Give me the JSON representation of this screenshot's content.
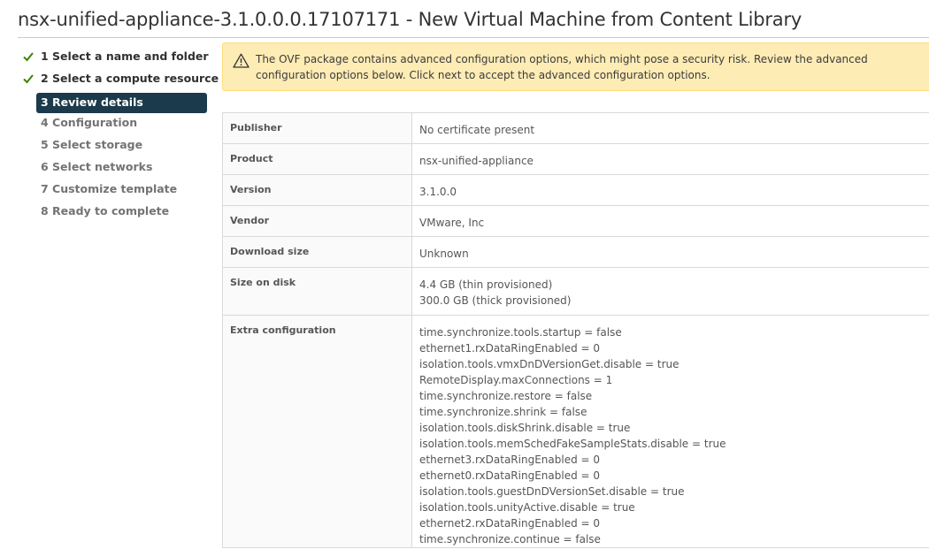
{
  "window": {
    "title": "nsx-unified-appliance-3.1.0.0.0.17107171 - New Virtual Machine from Content Library"
  },
  "steps": [
    {
      "label": "1 Select a name and folder",
      "state": "done"
    },
    {
      "label": "2 Select a compute resource",
      "state": "done"
    },
    {
      "label": "3 Review details",
      "state": "active"
    },
    {
      "label": "4 Configuration",
      "state": "pending"
    },
    {
      "label": "5 Select storage",
      "state": "pending"
    },
    {
      "label": "6 Select networks",
      "state": "pending"
    },
    {
      "label": "7 Customize template",
      "state": "pending"
    },
    {
      "label": "8 Ready to complete",
      "state": "pending"
    }
  ],
  "alert": {
    "icon": "warning-icon",
    "text": "The OVF package contains advanced configuration options, which might pose a security risk. Review the advanced configuration options below. Click next to accept the advanced configuration options."
  },
  "details": {
    "publisher": {
      "label": "Publisher",
      "value": "No certificate present"
    },
    "product": {
      "label": "Product",
      "value": "nsx-unified-appliance"
    },
    "version": {
      "label": "Version",
      "value": "3.1.0.0"
    },
    "vendor": {
      "label": "Vendor",
      "value": "VMware, Inc"
    },
    "download_size": {
      "label": "Download size",
      "value": "Unknown"
    },
    "size_on_disk": {
      "label": "Size on disk",
      "values": [
        "4.4 GB (thin provisioned)",
        "300.0 GB (thick provisioned)"
      ]
    },
    "extra_configuration": {
      "label": "Extra configuration",
      "values": [
        "time.synchronize.tools.startup = false",
        "ethernet1.rxDataRingEnabled = 0",
        "isolation.tools.vmxDnDVersionGet.disable = true",
        "RemoteDisplay.maxConnections = 1",
        "time.synchronize.restore = false",
        "time.synchronize.shrink = false",
        "isolation.tools.diskShrink.disable = true",
        "isolation.tools.memSchedFakeSampleStats.disable = true",
        "ethernet3.rxDataRingEnabled = 0",
        "ethernet0.rxDataRingEnabled = 0",
        "isolation.tools.guestDnDVersionSet.disable = true",
        "isolation.tools.unityActive.disable = true",
        "ethernet2.rxDataRingEnabled = 0",
        "time.synchronize.continue = false"
      ]
    }
  },
  "colors": {
    "active_step_bg": "#1b3a4b",
    "done_check": "#3c8500",
    "alert_bg": "#feecb5",
    "alert_border": "#ffdc7b"
  }
}
